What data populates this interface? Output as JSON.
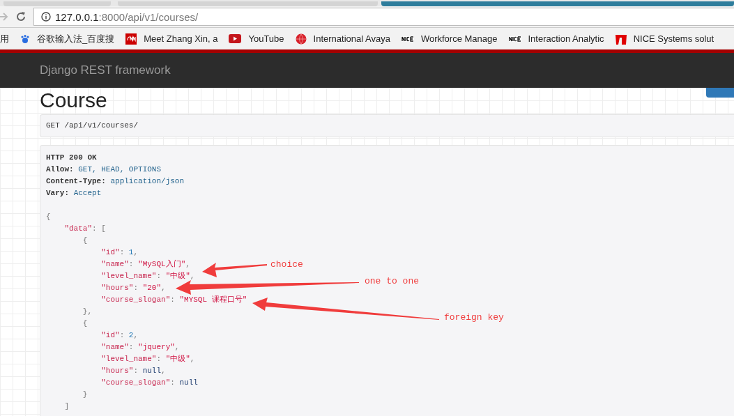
{
  "browser": {
    "tabs": [
      {
        "selected": false
      },
      {
        "selected": false
      },
      {
        "selected": true
      }
    ],
    "url_host": "127.0.0.1",
    "url_path": ":8000/api/v1/courses/",
    "bookmarks": [
      {
        "kind": "plain",
        "label": "用"
      },
      {
        "kind": "paw",
        "label": "谷歌输入法_百度搜"
      },
      {
        "kind": "cnn",
        "label": "Meet Zhang Xin, a"
      },
      {
        "kind": "play",
        "label": "YouTube"
      },
      {
        "kind": "globe",
        "label": "International Avaya"
      },
      {
        "kind": "nice",
        "label": "Workforce Manage"
      },
      {
        "kind": "nice",
        "label": "Interaction Analytic"
      },
      {
        "kind": "flag",
        "label": "NICE Systems solut"
      }
    ]
  },
  "navbar": {
    "brand": "Django REST framework"
  },
  "page": {
    "title": "Course",
    "request": {
      "method": "GET",
      "path": "/api/v1/courses/"
    },
    "response": {
      "status": "HTTP 200 OK",
      "headers": [
        {
          "name": "Allow:",
          "value": "GET, HEAD, OPTIONS"
        },
        {
          "name": "Content-Type:",
          "value": "application/json"
        },
        {
          "name": "Vary:",
          "value": "Accept"
        }
      ],
      "body": [
        [
          {
            "kind": "punct",
            "text": "{"
          }
        ],
        [
          {
            "kind": "key",
            "text": "    \"data\""
          },
          {
            "kind": "punct",
            "text": ": ["
          }
        ],
        [
          {
            "kind": "punct",
            "text": "        {"
          }
        ],
        [
          {
            "kind": "key",
            "text": "            \"id\""
          },
          {
            "kind": "punct",
            "text": ": "
          },
          {
            "kind": "number",
            "text": "1"
          },
          {
            "kind": "punct",
            "text": ","
          }
        ],
        [
          {
            "kind": "key",
            "text": "            \"name\""
          },
          {
            "kind": "punct",
            "text": ": "
          },
          {
            "kind": "string",
            "text": "\"MySQL入门\""
          },
          {
            "kind": "punct",
            "text": ","
          }
        ],
        [
          {
            "kind": "key",
            "text": "            \"level_name\""
          },
          {
            "kind": "punct",
            "text": ": "
          },
          {
            "kind": "string",
            "text": "\"中级\""
          },
          {
            "kind": "punct",
            "text": ","
          }
        ],
        [
          {
            "kind": "key",
            "text": "            \"hours\""
          },
          {
            "kind": "punct",
            "text": ": "
          },
          {
            "kind": "string",
            "text": "\"20\""
          },
          {
            "kind": "punct",
            "text": ","
          }
        ],
        [
          {
            "kind": "key",
            "text": "            \"course_slogan\""
          },
          {
            "kind": "punct",
            "text": ": "
          },
          {
            "kind": "string",
            "text": "\"MYSQL 课程口号\""
          }
        ],
        [
          {
            "kind": "punct",
            "text": "        },"
          }
        ],
        [
          {
            "kind": "punct",
            "text": "        {"
          }
        ],
        [
          {
            "kind": "key",
            "text": "            \"id\""
          },
          {
            "kind": "punct",
            "text": ": "
          },
          {
            "kind": "number",
            "text": "2"
          },
          {
            "kind": "punct",
            "text": ","
          }
        ],
        [
          {
            "kind": "key",
            "text": "            \"name\""
          },
          {
            "kind": "punct",
            "text": ": "
          },
          {
            "kind": "string",
            "text": "\"jquery\""
          },
          {
            "kind": "punct",
            "text": ","
          }
        ],
        [
          {
            "kind": "key",
            "text": "            \"level_name\""
          },
          {
            "kind": "punct",
            "text": ": "
          },
          {
            "kind": "string",
            "text": "\"中级\""
          },
          {
            "kind": "punct",
            "text": ","
          }
        ],
        [
          {
            "kind": "key",
            "text": "            \"hours\""
          },
          {
            "kind": "punct",
            "text": ": "
          },
          {
            "kind": "literal",
            "text": "null"
          },
          {
            "kind": "punct",
            "text": ","
          }
        ],
        [
          {
            "kind": "key",
            "text": "            \"course_slogan\""
          },
          {
            "kind": "punct",
            "text": ": "
          },
          {
            "kind": "literal",
            "text": "null"
          }
        ],
        [
          {
            "kind": "punct",
            "text": "        }"
          }
        ],
        [
          {
            "kind": "punct",
            "text": "    ]"
          }
        ]
      ]
    }
  },
  "annotations": [
    {
      "label": "choice"
    },
    {
      "label": "one to one"
    },
    {
      "label": "foreign key"
    }
  ]
}
